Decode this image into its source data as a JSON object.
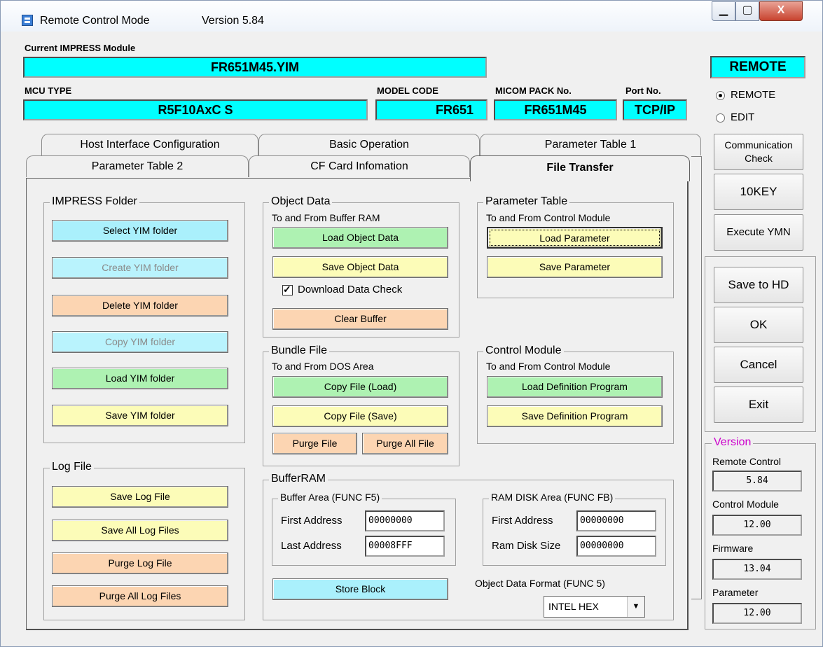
{
  "window": {
    "title": "Remote Control Mode",
    "version_text": "Version  5.84",
    "min_glyph": "▁",
    "max_glyph": "▢",
    "close_glyph": "X"
  },
  "module": {
    "label": "Current IMPRESS Module",
    "value": "FR651M45.YIM"
  },
  "mcu": {
    "type_label": "MCU TYPE",
    "type_value": "R5F10AxC S",
    "model_label": "MODEL CODE",
    "model_value": "FR651",
    "micom_label": "MICOM PACK No.",
    "micom_value": "FR651M45",
    "port_label": "Port No.",
    "port_value": "TCP/IP"
  },
  "mode": {
    "badge": "REMOTE",
    "remote_label": "REMOTE",
    "edit_label": "EDIT",
    "selected": "REMOTE"
  },
  "tabs": {
    "row1": [
      "Host Interface Configuration",
      "Basic Operation",
      "Parameter Table 1"
    ],
    "row2": [
      "Parameter Table 2",
      "CF Card Infomation",
      "File Transfer"
    ],
    "active": "File Transfer"
  },
  "impress_folder": {
    "title": "IMPRESS Folder",
    "buttons": [
      "Select YIM folder",
      "Create YIM folder",
      "Delete YIM folder",
      "Copy YIM folder",
      "Load YIM folder",
      "Save YIM folder"
    ]
  },
  "log_file": {
    "title": "Log File",
    "buttons": [
      "Save Log File",
      "Save All Log Files",
      "Purge Log File",
      "Purge All Log Files"
    ]
  },
  "object_data": {
    "title": "Object Data",
    "subtitle": "To and From Buffer RAM",
    "load": "Load Object Data",
    "save": "Save Object Data",
    "checkbox": "Download Data Check",
    "checked": true,
    "clear": "Clear Buffer"
  },
  "parameter_table": {
    "title": "Parameter Table",
    "subtitle": "To and From Control Module",
    "load": "Load Parameter",
    "save": "Save Parameter"
  },
  "bundle_file": {
    "title": "Bundle File",
    "subtitle": "To and From DOS Area",
    "copy_load": "Copy File (Load)",
    "copy_save": "Copy File (Save)",
    "purge": "Purge File",
    "purge_all": "Purge All File"
  },
  "control_module": {
    "title": "Control Module",
    "subtitle": "To and From Control Module",
    "load": "Load Definition Program",
    "save": "Save Definition Program"
  },
  "buffer_ram": {
    "title": "BufferRAM",
    "buffer_area_title": "Buffer Area (FUNC F5)",
    "first_address_label": "First  Address",
    "first_address": "00000000",
    "last_address_label": "Last  Address",
    "last_address": "00008FFF",
    "ram_disk_title": "RAM DISK Area (FUNC FB)",
    "ram_first_label": "First  Address",
    "ram_first": "00000000",
    "ram_size_label": "Ram Disk Size",
    "ram_size": "00000000",
    "store_block": "Store Block",
    "format_label": "Object Data Format (FUNC 5)",
    "format_value": "INTEL HEX"
  },
  "right_buttons": {
    "comm_check": "Communication Check",
    "tenkey": "10KEY",
    "execute": "Execute YMN",
    "save_hd": "Save to HD",
    "ok": "OK",
    "cancel": "Cancel",
    "exit": "Exit"
  },
  "version_panel": {
    "title": "Version",
    "title_color": "#cc00cc",
    "remote_label": "Remote Control",
    "remote_value": "5.84",
    "control_label": "Control Module",
    "control_value": "12.00",
    "firmware_label": "Firmware",
    "firmware_value": "13.04",
    "parameter_label": "Parameter",
    "parameter_value": "12.00"
  },
  "colors": {
    "cyan_field": "#00ffff",
    "btn_cyan": "#aaf0fc",
    "btn_orange": "#fcd5b2",
    "btn_green": "#aef2b2",
    "btn_yellow": "#fcfcb8"
  }
}
